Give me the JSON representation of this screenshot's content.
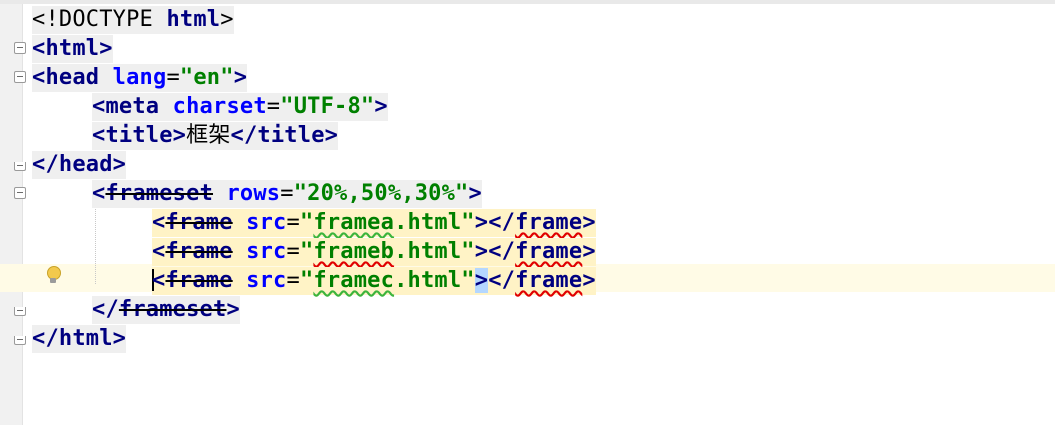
{
  "editor": {
    "lines": [
      [
        "<!DOCTYPE html>"
      ],
      [
        "<html>"
      ],
      [
        "<head lang=\"en\">"
      ],
      [
        "<meta charset=\"UTF-8\">"
      ],
      [
        "<title>",
        "框架",
        "</title>"
      ],
      [
        "</head>"
      ],
      [
        "<frameset rows=\"20%,50%,30%\">"
      ],
      [
        "<frame src=\"framea.html\"></frame>"
      ],
      [
        "<frame src=\"frameb.html\"></frame>"
      ],
      [
        "<frame src=\"framec.html\"></frame>"
      ],
      [
        "</frameset>"
      ],
      [
        "</html>"
      ]
    ],
    "tokens": {
      "doctype_open": "<!DOCTYPE ",
      "doctype_name": "html",
      "doctype_close": ">",
      "html_open": "<html>",
      "head_open": "<head ",
      "lang_attr": "lang",
      "eq": "=",
      "lang_val": "\"en\"",
      "gt": ">",
      "meta_open": "<meta ",
      "charset_attr": "charset",
      "charset_val": "\"UTF-8\"",
      "title_open": "<title>",
      "title_text": "框架",
      "title_close": "</title>",
      "head_close": "</head>",
      "frameset_lt": "<",
      "frameset_name": "frameset",
      "space": " ",
      "rows_attr": "rows",
      "rows_val": "\"20%,50%,30%\"",
      "frame_lt": "<",
      "frame_name": "frame",
      "src_attr": "src",
      "framea_q1": "\"",
      "framea_name": "framea",
      "html_ext": ".html",
      "q2": "\"",
      "frameb_name": "frameb",
      "framec_name": "framec",
      "frame_close_lt": "</",
      "frameset_close_lt": "</",
      "html_close": "</html>"
    }
  }
}
